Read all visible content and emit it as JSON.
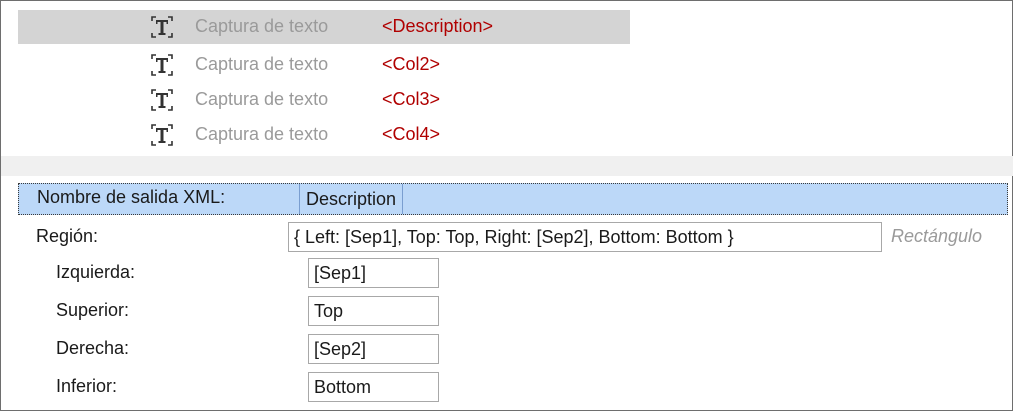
{
  "tree": {
    "items": [
      {
        "label": "Captura de texto",
        "tag": "<Description>",
        "selected": true
      },
      {
        "label": "Captura de texto",
        "tag": "<Col2>",
        "selected": false
      },
      {
        "label": "Captura de texto",
        "tag": "<Col3>",
        "selected": false
      },
      {
        "label": "Captura de texto",
        "tag": "<Col4>",
        "selected": false
      }
    ],
    "icon": "text-capture-icon"
  },
  "properties": {
    "output_name": {
      "label": "Nombre de salida XML:",
      "value": "Description"
    },
    "region": {
      "label": "Región:",
      "value": "{ Left: [Sep1], Top: Top, Right: [Sep2], Bottom: Bottom }",
      "hint": "Rectángulo"
    },
    "left": {
      "label": "Izquierda:",
      "value": "[Sep1]"
    },
    "top": {
      "label": "Superior:",
      "value": "Top"
    },
    "right": {
      "label": "Derecha:",
      "value": "[Sep2]"
    },
    "bottom": {
      "label": "Inferior:",
      "value": "Bottom"
    }
  },
  "colors": {
    "selection_gray": "#d4d4d4",
    "header_blue": "#bcd8f8",
    "tag_red": "#b00000",
    "muted_gray": "#9a9a9a"
  }
}
